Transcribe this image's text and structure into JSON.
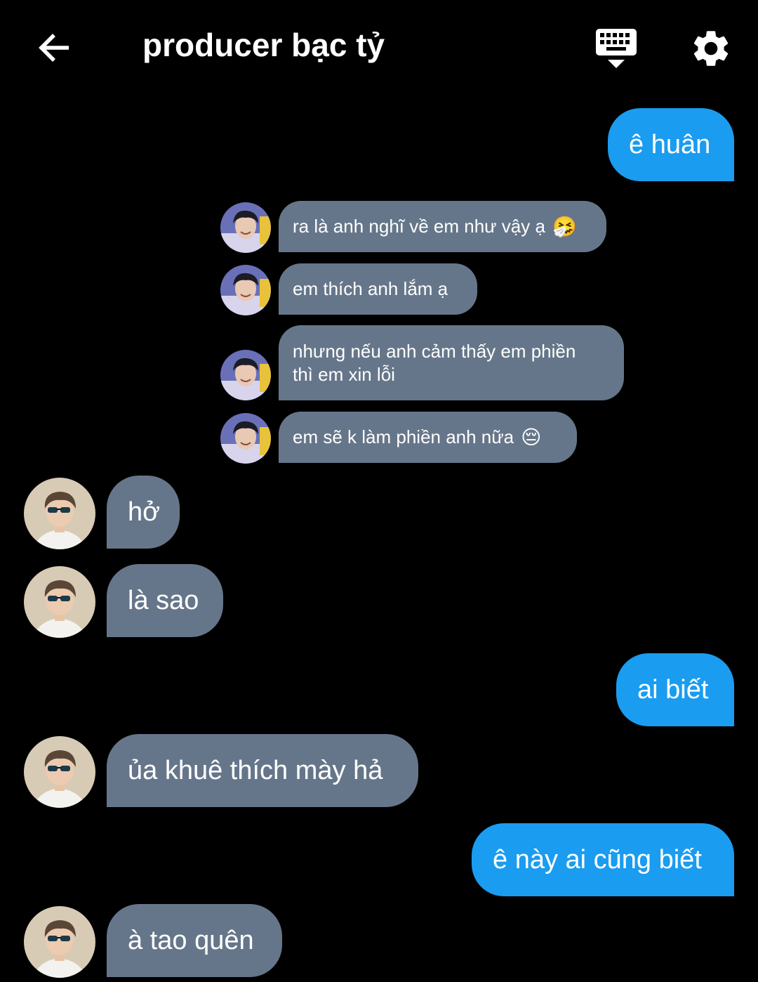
{
  "header": {
    "title": "producer bạc tỷ",
    "back_icon": "arrow-left-icon",
    "keyboard_icon": "keyboard-icon",
    "settings_icon": "gear-icon"
  },
  "colors": {
    "background": "#000000",
    "my_bubble": "#1a9cf0",
    "their_bubble": "#66768a",
    "text": "#ffffff"
  },
  "messages": [
    {
      "sender": "me",
      "text": "ê huân"
    },
    {
      "sender": "khue",
      "text": "ra là anh nghĩ về em như vậy ạ",
      "emoji": "🤧"
    },
    {
      "sender": "khue",
      "text": "em thích anh lắm ạ"
    },
    {
      "sender": "khue",
      "lines": [
        "nhưng nếu anh cảm thấy em phiền",
        "thì em xin lỗi"
      ]
    },
    {
      "sender": "khue",
      "text": "em sẽ k làm phiền anh nữa",
      "emoji": "😔"
    },
    {
      "sender": "huan",
      "text": "hở"
    },
    {
      "sender": "huan",
      "text": "là sao"
    },
    {
      "sender": "me",
      "text": "ai biết"
    },
    {
      "sender": "huan",
      "text": "ủa khuê thích mày hả"
    },
    {
      "sender": "me",
      "text": "ê này ai cũng biết"
    },
    {
      "sender": "huan",
      "text": "à tao quên"
    }
  ]
}
